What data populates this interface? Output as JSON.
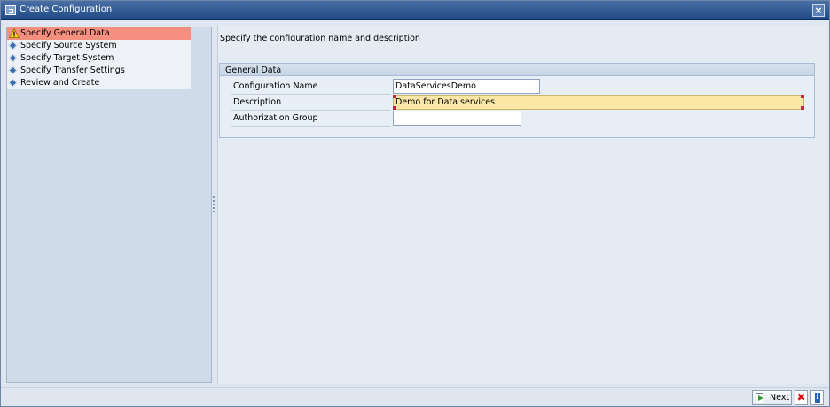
{
  "window": {
    "title": "Create Configuration",
    "close_icon": "close-icon"
  },
  "steps": [
    {
      "label": "Specify General Data",
      "icon": "warning-icon",
      "active": true
    },
    {
      "label": "Specify Source System",
      "icon": "diamond-bullet-icon",
      "active": false
    },
    {
      "label": "Specify Target System",
      "icon": "diamond-bullet-icon",
      "active": false
    },
    {
      "label": "Specify Transfer Settings",
      "icon": "diamond-bullet-icon",
      "active": false
    },
    {
      "label": "Review and Create",
      "icon": "diamond-bullet-icon",
      "active": false
    }
  ],
  "main": {
    "instruction": "Specify the configuration name and description",
    "group_title": "General Data",
    "fields": {
      "config_name": {
        "label": "Configuration Name",
        "value": "DataServicesDemo"
      },
      "description": {
        "label": "Description",
        "value": "Demo for Data services"
      },
      "auth_group": {
        "label": "Authorization Group",
        "value": ""
      }
    }
  },
  "footer": {
    "next_label": "Next",
    "next_icon": "next-icon",
    "cancel_icon": "cancel-icon",
    "info_icon": "info-icon"
  },
  "colors": {
    "title_bar": "#1f4a86",
    "active_step": "#f58f7f",
    "highlight_field": "#fbe8a6",
    "cancel": "#dd1111"
  }
}
